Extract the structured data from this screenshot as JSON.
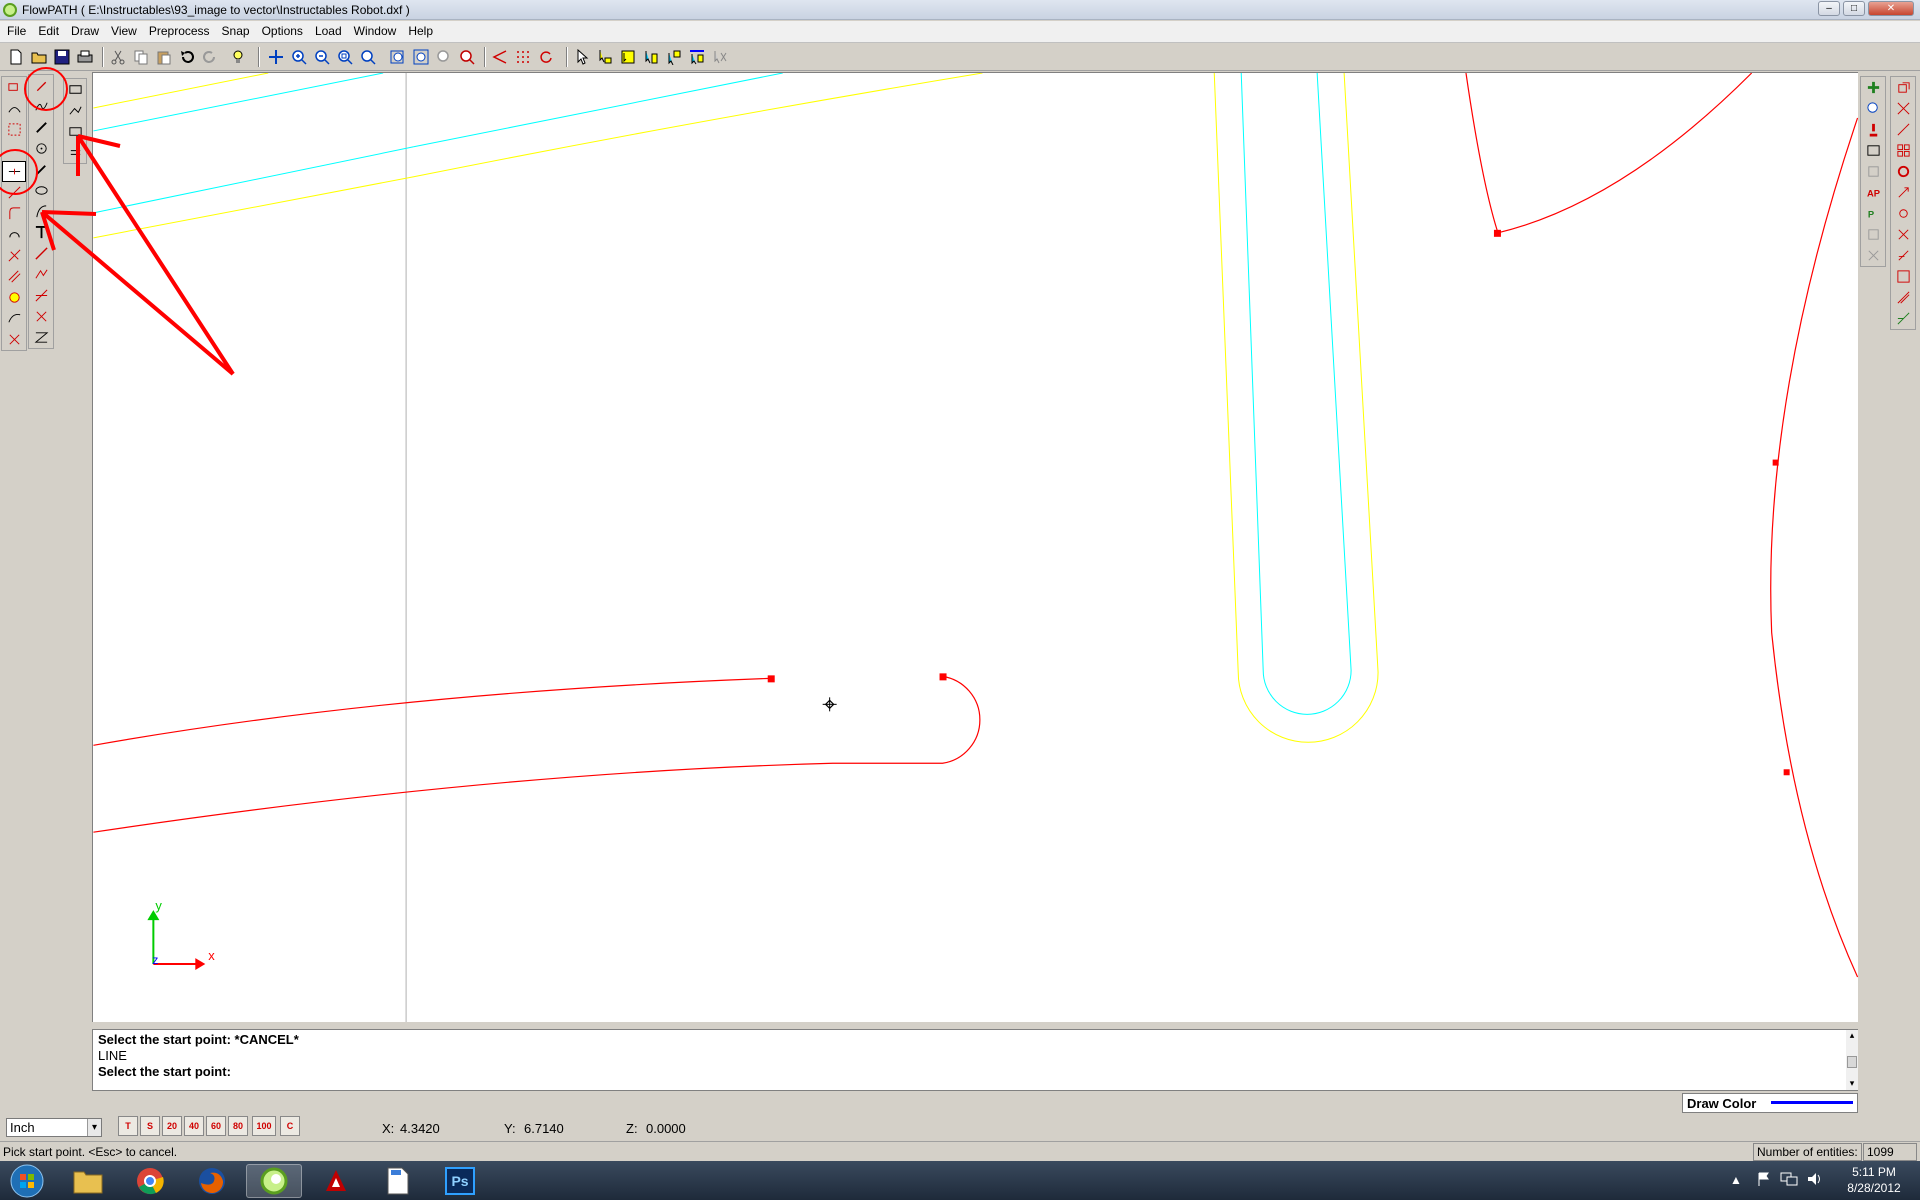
{
  "window": {
    "title": "FlowPATH ( E:\\Instructables\\93_image to vector\\Instructables Robot.dxf )",
    "controls": {
      "minimize": "–",
      "maximize": "□",
      "close": "✕"
    }
  },
  "menu": [
    "File",
    "Edit",
    "Draw",
    "View",
    "Preprocess",
    "Snap",
    "Options",
    "Load",
    "Window",
    "Help"
  ],
  "command": {
    "lines": [
      "Select the start point: *CANCEL*",
      "LINE",
      "Select the start point:"
    ],
    "scroll_up": "▴",
    "scroll_down": "▾"
  },
  "draw_color": {
    "label": "Draw Color",
    "color": "#0000ff"
  },
  "units": {
    "selected": "Inch",
    "arrow": "▾"
  },
  "snap_buttons": [
    "T",
    "S",
    "20",
    "40",
    "60",
    "80",
    "100",
    "C"
  ],
  "coords": {
    "x_label": "X:",
    "x": "4.3420",
    "y_label": "Y:",
    "y": "6.7140",
    "z_label": "Z:",
    "z": "0.0000"
  },
  "status": {
    "hint": "Pick start point. <Esc> to cancel.",
    "entities_label": "Number of entities:",
    "entities": "1099"
  },
  "axis": {
    "x": "x",
    "y": "y",
    "z": "z"
  },
  "taskbar": {
    "apps": [
      "start-orb",
      "explorer",
      "chrome",
      "firefox",
      "flowpath",
      "acrobat",
      "pdf-document",
      "photoshop"
    ],
    "photoshop_label": "Ps",
    "time": "5:11 PM",
    "date": "8/28/2012"
  },
  "colors": {
    "entity": "#ff0000",
    "offset_outer": "#ffff00",
    "offset_inner": "#00ffff",
    "annotation": "#ff0000",
    "axis_x": "#ff0000",
    "axis_y": "#00cc00"
  }
}
